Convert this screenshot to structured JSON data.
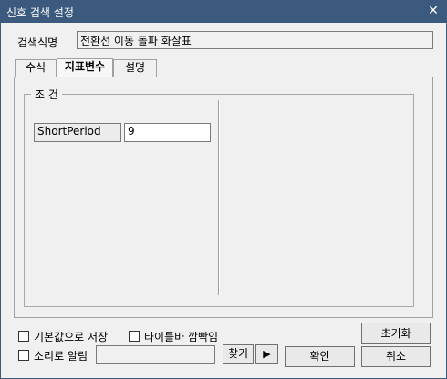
{
  "window": {
    "title": "신호 검색 설정",
    "close": "✕"
  },
  "search_name": {
    "label": "검색식명",
    "value": "전환선 이동 돌파 화살표"
  },
  "tabs": [
    {
      "label": "수식",
      "active": false
    },
    {
      "label": "지표변수",
      "active": true
    },
    {
      "label": "설명",
      "active": false
    }
  ],
  "conditions": {
    "legend": "조 건",
    "params": [
      {
        "name": "ShortPeriod",
        "value": "9"
      }
    ]
  },
  "options": {
    "save_default": "기본값으로 저장",
    "flash_titlebar": "타이틀바 깜빡임",
    "sound_alert": "소리로 알림",
    "sound_file": ""
  },
  "buttons": {
    "find": "찾기",
    "play": "▶",
    "reset": "초기화",
    "ok": "확인",
    "cancel": "취소"
  }
}
